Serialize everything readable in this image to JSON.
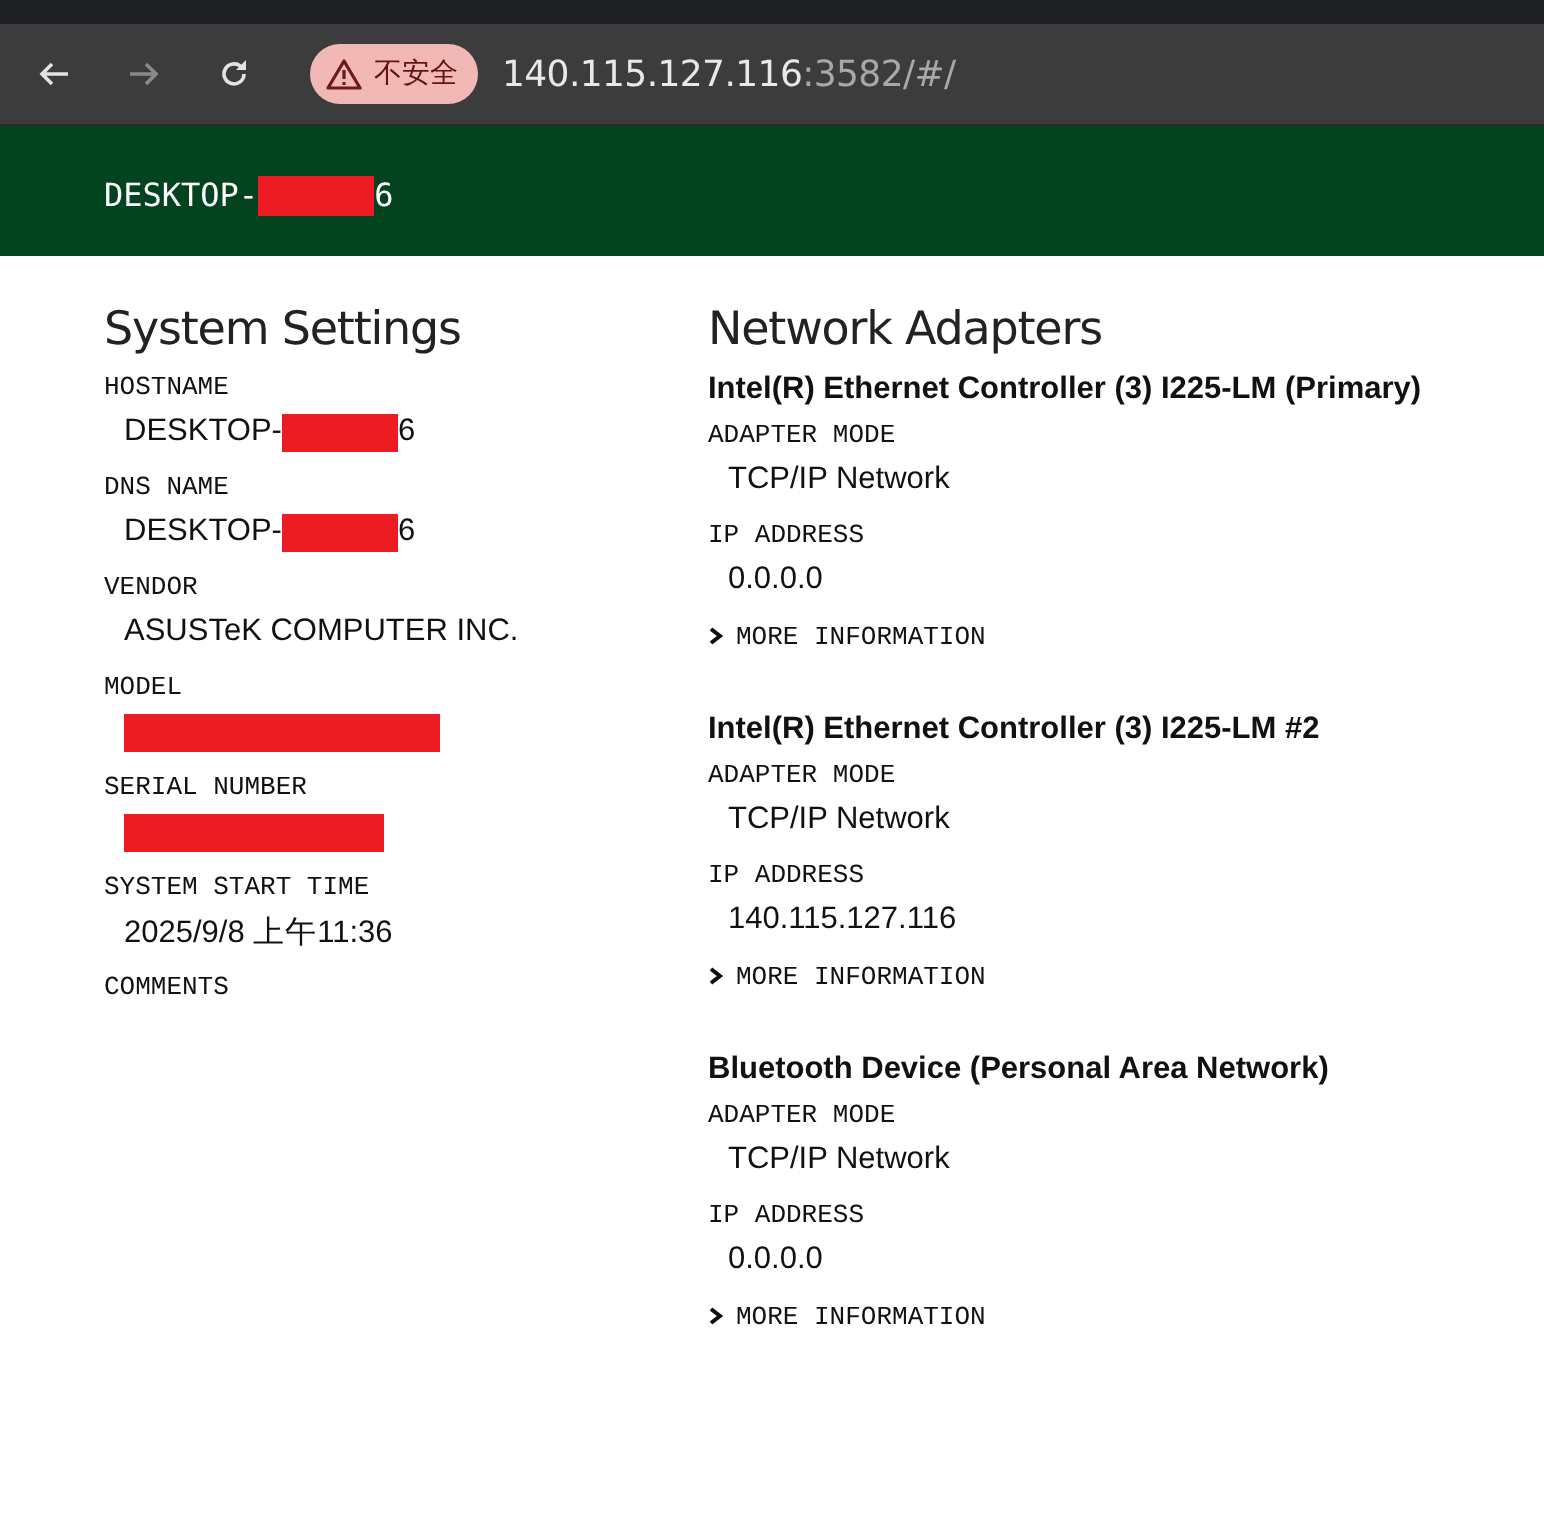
{
  "browser": {
    "nav": [
      {
        "kind": "back",
        "disabled": false
      },
      {
        "kind": "forward",
        "disabled": true
      },
      {
        "kind": "reload",
        "disabled": false
      }
    ],
    "security_badge": "不安全",
    "address": {
      "host": "140.115.127.116",
      "rest": ":3582/#/"
    }
  },
  "header": {
    "title": [
      {
        "kind": "text",
        "text": "DESKTOP-"
      },
      {
        "kind": "redaction"
      },
      {
        "kind": "text",
        "text": "6"
      }
    ]
  },
  "system_settings": {
    "title": "System Settings",
    "fields": [
      {
        "label": "HOSTNAME",
        "value": [
          {
            "kind": "text",
            "text": "DESKTOP-"
          },
          {
            "kind": "redaction"
          },
          {
            "kind": "text",
            "text": "6"
          }
        ]
      },
      {
        "label": "DNS NAME",
        "value": [
          {
            "kind": "text",
            "text": "DESKTOP-"
          },
          {
            "kind": "redaction"
          },
          {
            "kind": "text",
            "text": "6"
          }
        ]
      },
      {
        "label": "VENDOR",
        "value": [
          {
            "kind": "text",
            "text": "ASUSTeK COMPUTER INC."
          }
        ]
      },
      {
        "label": "MODEL",
        "value": [
          {
            "kind": "redaction"
          }
        ]
      },
      {
        "label": "SERIAL NUMBER",
        "value": [
          {
            "kind": "redaction"
          }
        ]
      },
      {
        "label": "SYSTEM START TIME",
        "value": [
          {
            "kind": "text",
            "text": "2025/9/8 上午11:36"
          }
        ]
      },
      {
        "label": "COMMENTS"
      }
    ]
  },
  "network_adapters": {
    "title": "Network Adapters",
    "adapters": [
      {
        "name": "Intel(R) Ethernet Controller (3) I225-LM (Primary)",
        "fields": [
          {
            "label": "ADAPTER MODE",
            "value": "TCP/IP Network"
          },
          {
            "label": "IP ADDRESS",
            "value": "0.0.0.0"
          }
        ],
        "more": {
          "label": "MORE INFORMATION",
          "expanded": false
        }
      },
      {
        "name": "Intel(R) Ethernet Controller (3) I225-LM #2",
        "fields": [
          {
            "label": "ADAPTER MODE",
            "value": "TCP/IP Network"
          },
          {
            "label": "IP ADDRESS",
            "value": "140.115.127.116"
          }
        ],
        "more": {
          "label": "MORE INFORMATION",
          "expanded": false
        }
      },
      {
        "name": "Bluetooth Device (Personal Area Network)",
        "fields": [
          {
            "label": "ADAPTER MODE",
            "value": "TCP/IP Network"
          },
          {
            "label": "IP ADDRESS",
            "value": "0.0.0.0"
          }
        ],
        "more": {
          "label": "MORE INFORMATION",
          "expanded": false
        }
      }
    ]
  }
}
